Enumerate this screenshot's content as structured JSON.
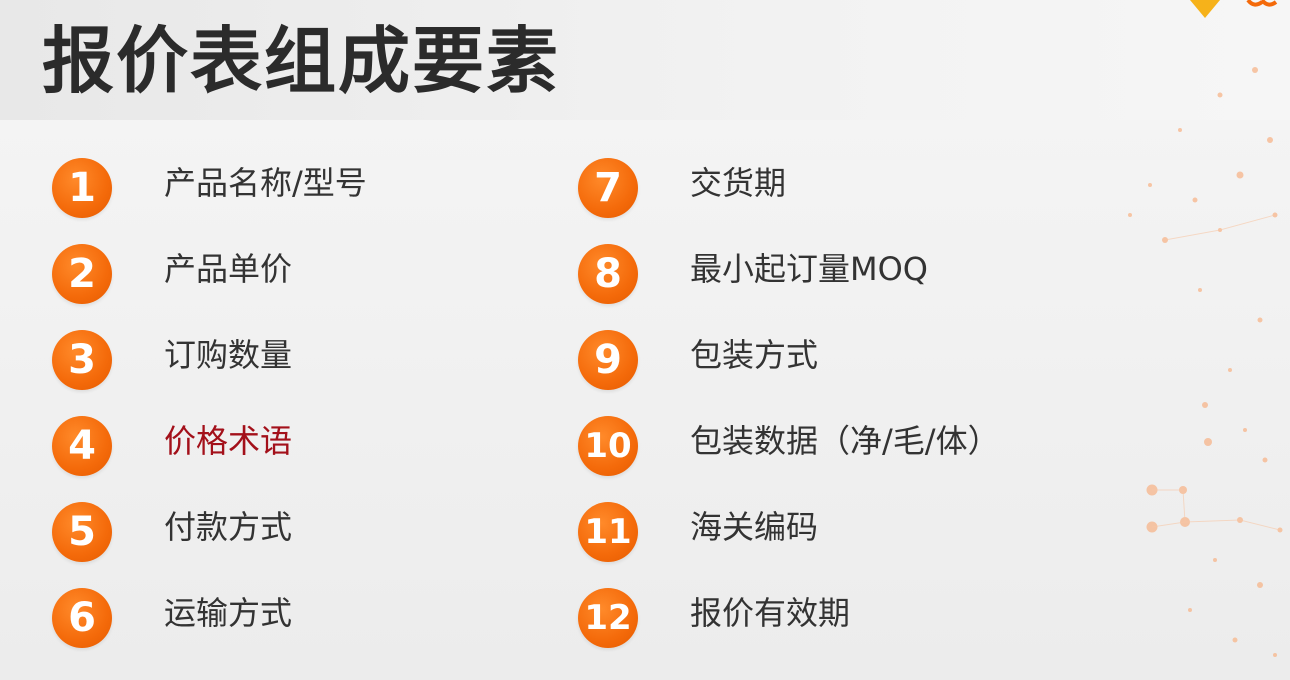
{
  "title": "报价表组成要素",
  "colors": {
    "accent": "#f46a0a",
    "highlight": "#a3101a",
    "text": "#333333",
    "title": "#2b2b2b"
  },
  "items": [
    {
      "num": "1",
      "label": "产品名称/型号"
    },
    {
      "num": "2",
      "label": "产品单价"
    },
    {
      "num": "3",
      "label": "订购数量"
    },
    {
      "num": "4",
      "label": "价格术语",
      "highlight": true
    },
    {
      "num": "5",
      "label": "付款方式"
    },
    {
      "num": "6",
      "label": "运输方式"
    },
    {
      "num": "7",
      "label": "交货期"
    },
    {
      "num": "8",
      "label": "最小起订量MOQ"
    },
    {
      "num": "9",
      "label": "包装方式"
    },
    {
      "num": "10",
      "label": "包装数据（净/毛/体）"
    },
    {
      "num": "11",
      "label": "海关编码"
    },
    {
      "num": "12",
      "label": "报价有效期"
    }
  ]
}
